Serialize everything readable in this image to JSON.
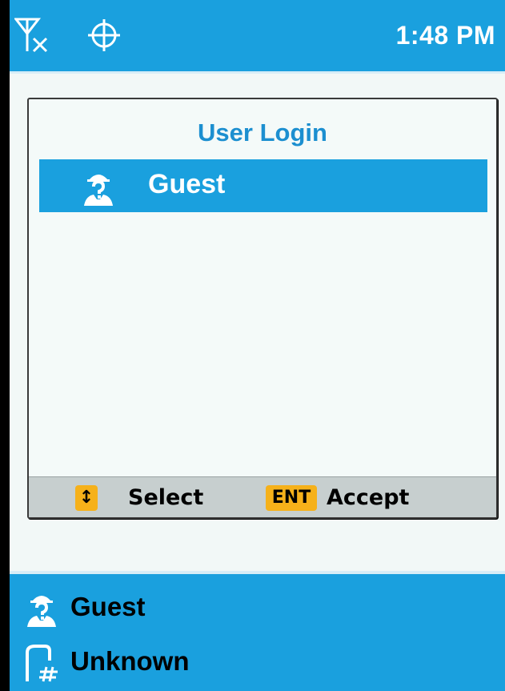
{
  "status_bar": {
    "background": "#1aa0de",
    "icons": [
      "no-signal-antenna-icon",
      "gps-crosshair-icon"
    ],
    "time": "1:48 PM"
  },
  "dialog": {
    "title": "User Login",
    "items": [
      {
        "icon": "guest-user-icon",
        "label": "Guest",
        "selected": true
      }
    ],
    "footer": {
      "select_key": "↕",
      "select_label": "Select",
      "accept_key": "ENT",
      "accept_label": "Accept"
    }
  },
  "bottom_panel": {
    "user_icon": "guest-user-icon",
    "user_label": "Guest",
    "phone_icon": "phone-number-icon",
    "phone_label": "Unknown"
  }
}
